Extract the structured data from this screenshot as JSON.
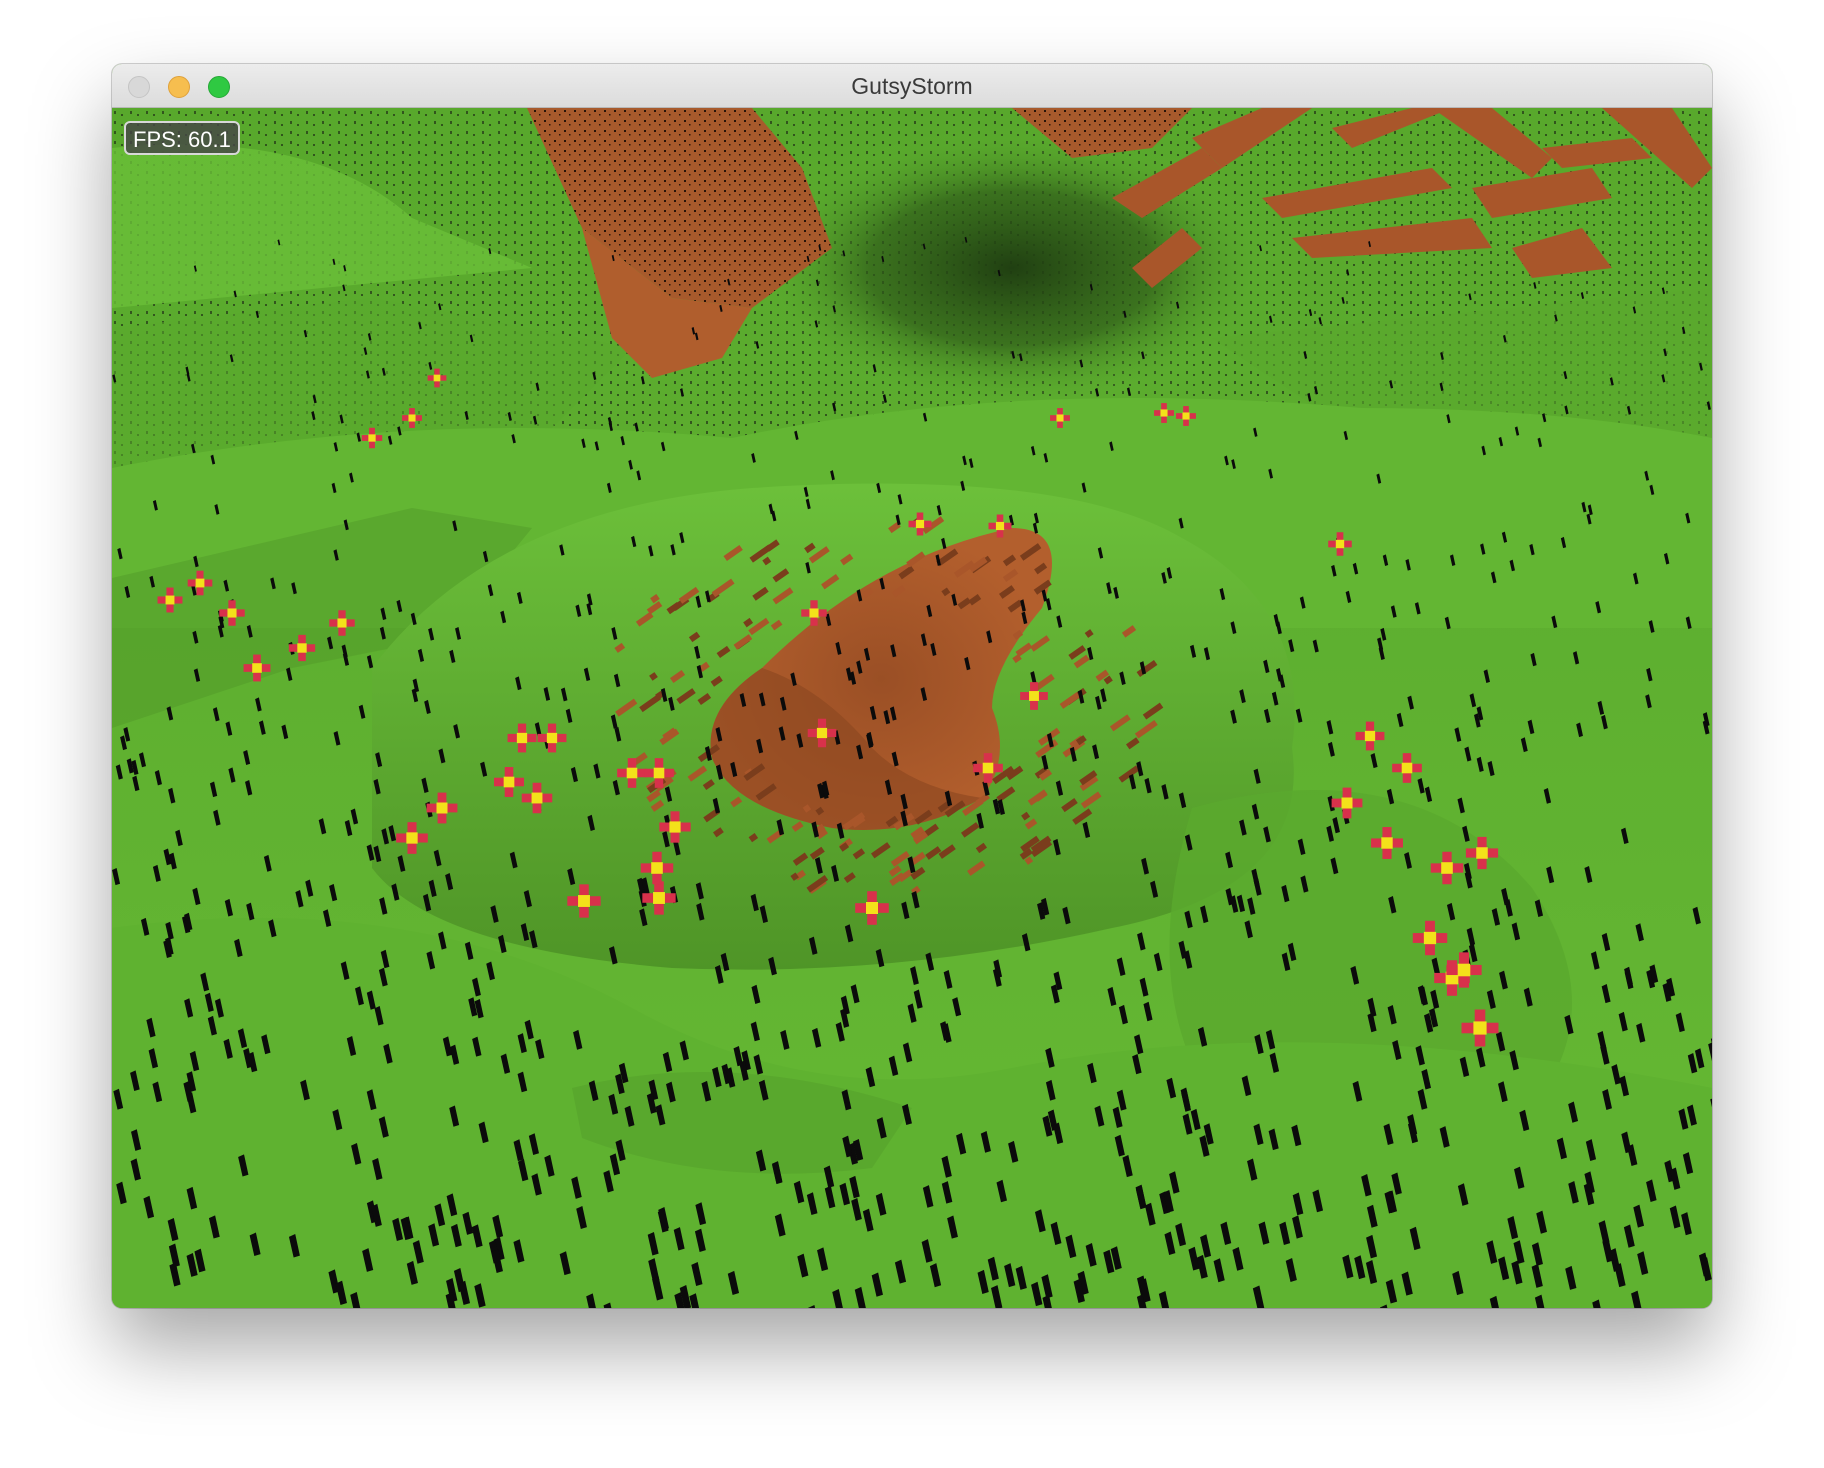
{
  "window": {
    "title": "GutsyStorm",
    "controls": [
      "close",
      "minimize",
      "zoom"
    ]
  },
  "hud": {
    "fps_text": "FPS: 60.1"
  },
  "scene": {
    "description_icons": [
      "grass-terrain",
      "dirt-patch",
      "red-flower",
      "cave-entrance"
    ],
    "colors": {
      "grass": "#62b631",
      "grass_shadow": "#4d9226",
      "dirt": "#a9562a",
      "dirt_dark": "#7a3d1c",
      "flower_petal": "#d8314b",
      "flower_center": "#f3e21a",
      "grass_blade": "#0b0b0b"
    }
  }
}
